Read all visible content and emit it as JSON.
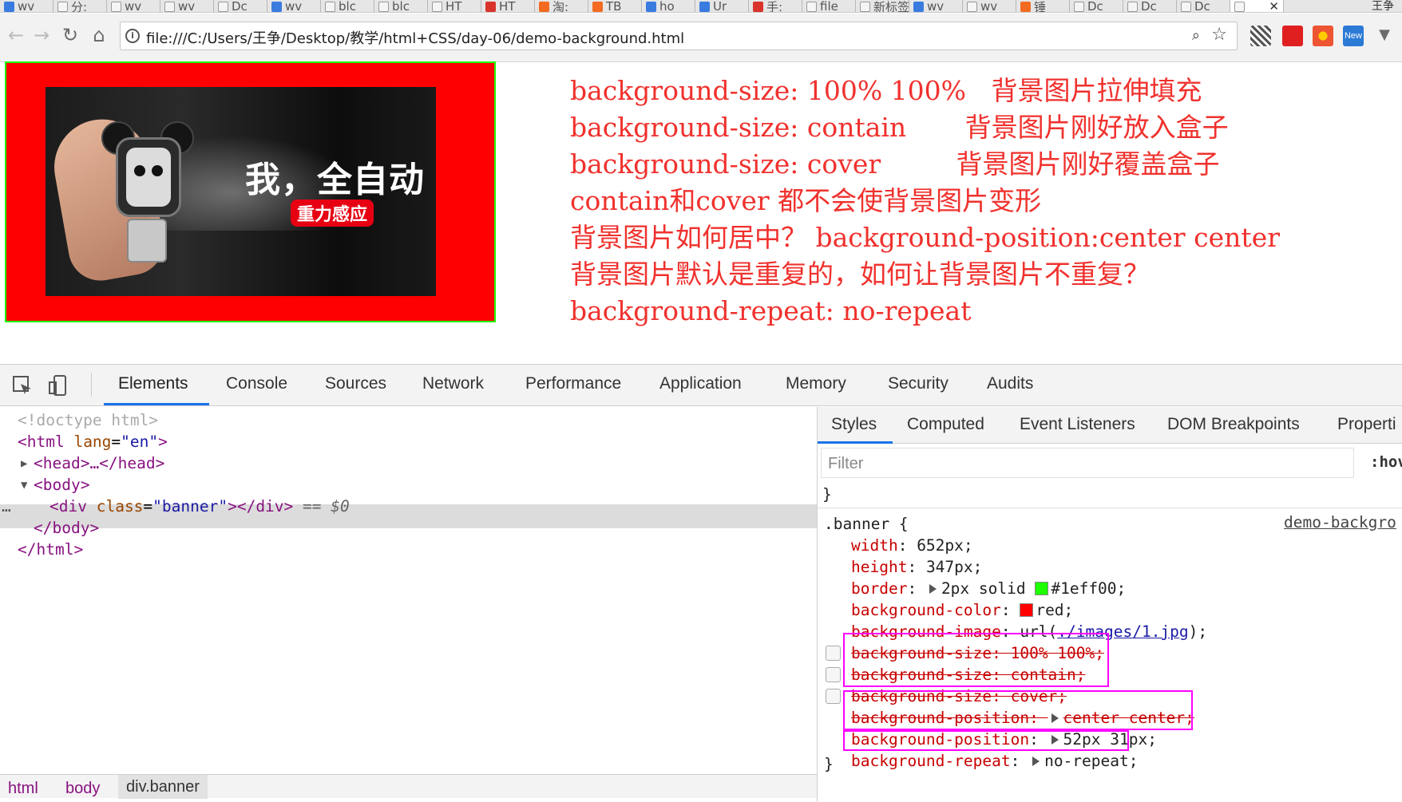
{
  "tabs": [
    {
      "label": "wv",
      "icon": "paw-icon"
    },
    {
      "label": "分:",
      "icon": "doc-icon"
    },
    {
      "label": "wv",
      "icon": "doc-icon"
    },
    {
      "label": "wv",
      "icon": "grid-icon"
    },
    {
      "label": "Dc",
      "icon": "doc-icon"
    },
    {
      "label": "wv",
      "icon": "paw-icon"
    },
    {
      "label": "blc",
      "icon": "c-icon"
    },
    {
      "label": "blc",
      "icon": "c-icon"
    },
    {
      "label": "HT",
      "icon": "doc-icon"
    },
    {
      "label": "HT",
      "icon": "red-icon"
    },
    {
      "label": "淘:",
      "icon": "taobao-icon"
    },
    {
      "label": "TB",
      "icon": "taobao-icon"
    },
    {
      "label": "ho",
      "icon": "paw-icon"
    },
    {
      "label": "Ur",
      "icon": "blue-icon"
    },
    {
      "label": "手:",
      "icon": "weibo-icon"
    },
    {
      "label": "file",
      "icon": "doc-icon"
    },
    {
      "label": "新标签",
      "icon": "doc-icon"
    },
    {
      "label": "wv",
      "icon": "paw-icon"
    },
    {
      "label": "wv",
      "icon": "m-icon"
    },
    {
      "label": "锤",
      "icon": "s-icon"
    },
    {
      "label": "Dc",
      "icon": "doc-icon"
    },
    {
      "label": "Dc",
      "icon": "doc-icon"
    },
    {
      "label": "Dc",
      "icon": "doc-icon"
    },
    {
      "label": "",
      "icon": "doc-icon",
      "active": true
    }
  ],
  "window_user": "王争",
  "address": {
    "url": "file:///C:/Users/王争/Desktop/教学/html+CSS/day-06/demo-background.html",
    "zoom_icon": "zoom-icon",
    "star_icon": "star-icon"
  },
  "extensions": {
    "new_badge": "New"
  },
  "banner": {
    "slogan": "我，全自动",
    "subslogan": "重力感应"
  },
  "notes": [
    "background-size: 100% 100%   背景图片拉伸填充",
    "background-size: contain       背景图片刚好放入盒子",
    "background-size: cover         背景图片刚好覆盖盒子",
    "contain和cover 都不会使背景图片变形",
    "背景图片如何居中？ background-position:center center",
    "背景图片默认是重复的，如何让背景图片不重复？",
    "background-repeat: no-repeat"
  ],
  "devtools": {
    "tabs": [
      "Elements",
      "Console",
      "Sources",
      "Network",
      "Performance",
      "Application",
      "Memory",
      "Security",
      "Audits"
    ],
    "active_tab": "Elements",
    "dom": {
      "doctype": "<!doctype html>",
      "html_open": "<html",
      "html_attr": "lang",
      "html_val": "\"en\"",
      "head": "<head>…</head>",
      "body_open": "<body>",
      "div_tag_open": "<div",
      "div_attr": "class",
      "div_val": "\"banner\"",
      "div_close": "></div>",
      "eq_marker": "== $0",
      "body_close": "</body>",
      "html_close": "</html>"
    },
    "breadcrumbs": [
      "html",
      "body",
      "div.banner"
    ],
    "styles": {
      "tabs": [
        "Styles",
        "Computed",
        "Event Listeners",
        "DOM Breakpoints",
        "Properti"
      ],
      "filter_placeholder": "Filter",
      "hov": ":hov",
      "prev_rule_close": "}",
      "selector": ".banner {",
      "source": "demo-backgro",
      "rules": [
        {
          "prop": "width",
          "value": "652px;"
        },
        {
          "prop": "height",
          "value": "347px;"
        },
        {
          "prop": "border",
          "value": "2px solid",
          "swatch": "#1eff00",
          "swatch_label": "#1eff00;"
        },
        {
          "prop": "background-color",
          "swatch": "#ff0000",
          "swatch_label": "red;"
        },
        {
          "prop": "background-image",
          "value": "url(",
          "link": "./images/1.jpg",
          "after": ");"
        },
        {
          "prop": "background-size",
          "value": "100% 100%;",
          "struck": true,
          "checkbox": true
        },
        {
          "prop": "background-size",
          "value": "contain;",
          "struck": true,
          "checkbox": true
        },
        {
          "prop": "background-size",
          "value": "cover;",
          "struck": true,
          "checkbox": true
        },
        {
          "prop": "background-position",
          "value": "center center;",
          "struck": true
        },
        {
          "prop": "background-position",
          "value": "52px 31px;"
        },
        {
          "prop": "background-repeat",
          "value": "no-repeat;"
        }
      ],
      "rule_close": "}"
    },
    "highlight_color": "#ff00ff"
  }
}
